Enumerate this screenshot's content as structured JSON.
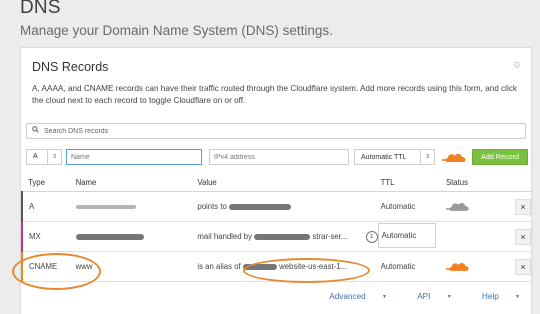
{
  "page": {
    "title": "DNS",
    "subtitle": "Manage your Domain Name System (DNS) settings."
  },
  "card": {
    "title": "DNS Records",
    "description": "A, AAAA, and CNAME records can have their traffic routed through the Cloudflare system. Add more records using this form, and click the cloud next to each record to toggle Cloudflare on or off."
  },
  "search": {
    "placeholder": "Search DNS records"
  },
  "add_form": {
    "type_value": "A",
    "name_placeholder": "Name",
    "value_placeholder": "IPv4 address",
    "ttl_value": "Automatic TTL",
    "add_button_label": "Add Record"
  },
  "table": {
    "headers": {
      "type": "Type",
      "name": "Name",
      "value": "Value",
      "ttl": "TTL",
      "status": "Status"
    },
    "rows": [
      {
        "type": "A",
        "name": "",
        "value_prefix": "points to",
        "value_suffix": "",
        "ttl": "Automatic",
        "status": "dns-only"
      },
      {
        "type": "MX",
        "name": "",
        "value_prefix": "mail handled by",
        "value_suffix": "strar-ser...",
        "priority": "1",
        "ttl": "Automatic",
        "status": "none"
      },
      {
        "type": "CNAME",
        "name": "www",
        "value_prefix": "is an alias of",
        "value_suffix": "website-us-east-1...",
        "ttl": "Automatic",
        "status": "proxied"
      }
    ],
    "delete_label": "×"
  },
  "footer": {
    "advanced": "Advanced",
    "api": "API",
    "help": "Help"
  },
  "colors": {
    "accent_green": "#7ac142",
    "cloud_orange": "#f38020",
    "cloud_grey": "#9a9a9a",
    "annotation_orange": "#e8892e",
    "link_blue": "#3b73b9"
  }
}
